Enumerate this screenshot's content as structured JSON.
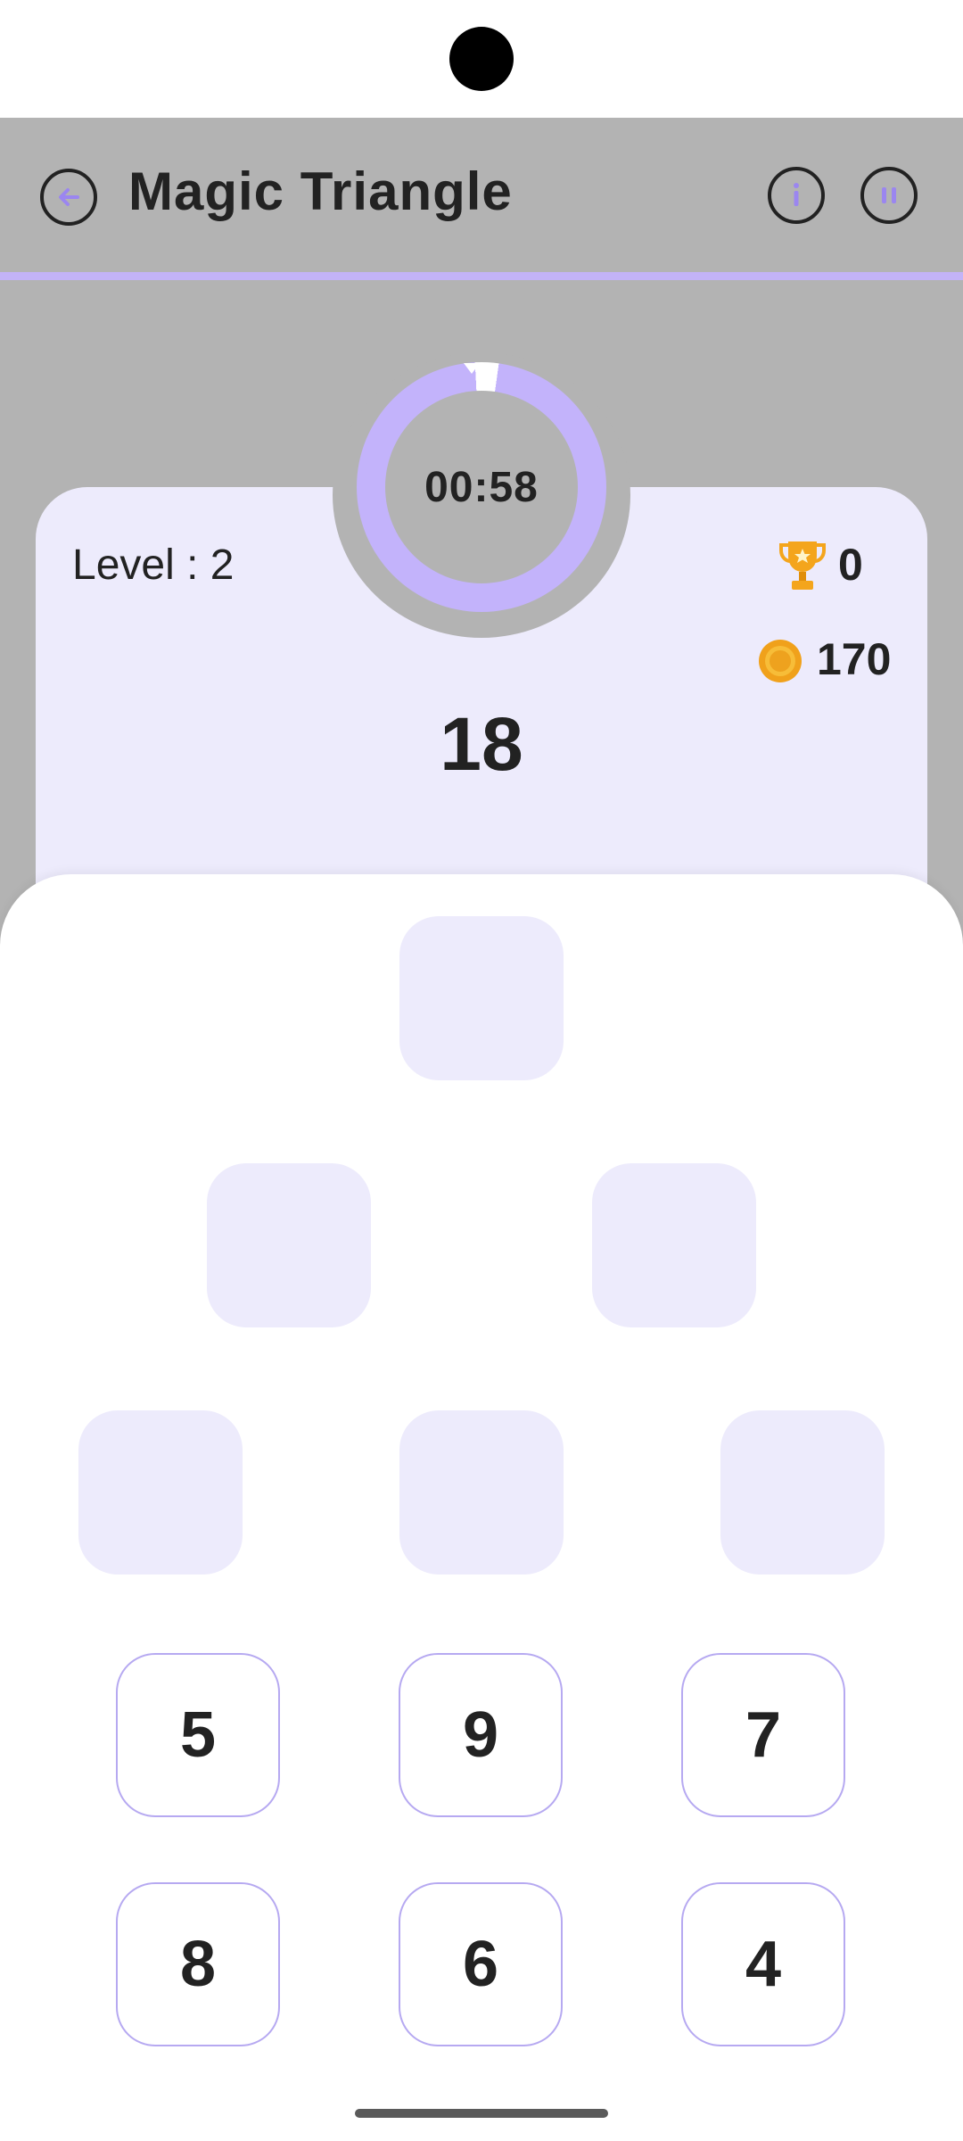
{
  "app_bar": {
    "title": "Magic Triangle",
    "back_icon": "back-arrow-icon",
    "info_icon": "info-icon",
    "pause_icon": "pause-icon"
  },
  "timer": {
    "text": "00:58",
    "progress": 0.97
  },
  "stats": {
    "level_label": "Level : 2",
    "trophies": "0",
    "coins": "170"
  },
  "target": "18",
  "slots": [
    "",
    "",
    "",
    "",
    "",
    ""
  ],
  "number_buttons": [
    "5",
    "9",
    "7",
    "8",
    "6",
    "4"
  ],
  "colors": {
    "accent": "#c3b3fb",
    "card_bg": "#edebfc",
    "button_border": "#b6a9f1",
    "dim_overlay": "#b3b3b3"
  }
}
